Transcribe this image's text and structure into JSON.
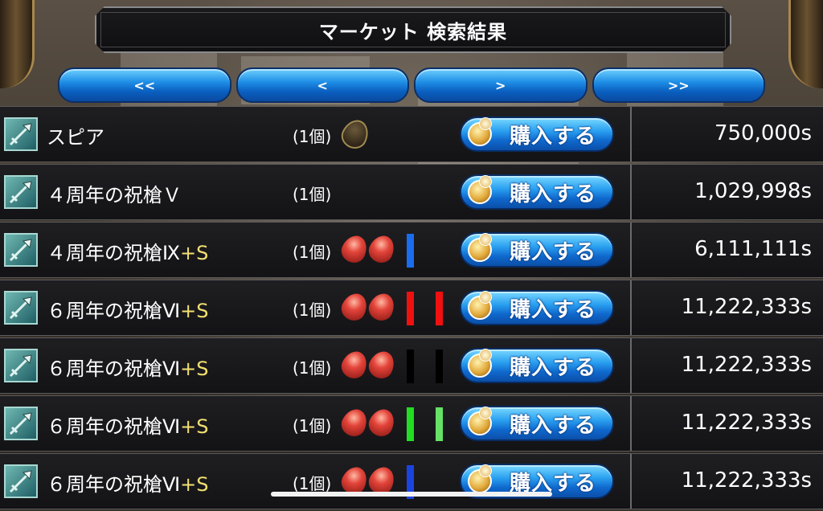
{
  "header": {
    "title": "マーケット 検索結果"
  },
  "nav": {
    "first_label": "<<",
    "prev_label": "<",
    "next_label": ">",
    "last_label": ">>"
  },
  "buy_label": "購入する",
  "rows": [
    {
      "name": "スピア",
      "plus": "",
      "qty": "(1個)",
      "gems": "empty",
      "bars": [],
      "price": "750,000s"
    },
    {
      "name": "４周年の祝槍Ｖ",
      "plus": "",
      "qty": "(1個)",
      "gems": "none",
      "bars": [],
      "price": "1,029,998s"
    },
    {
      "name": "４周年の祝槍Ⅸ",
      "plus": "+S",
      "qty": "(1個)",
      "gems": "red2",
      "bars": [
        "#1a6cf0"
      ],
      "price": "6,111,111s"
    },
    {
      "name": "６周年の祝槍Ⅵ",
      "plus": "+S",
      "qty": "(1個)",
      "gems": "red2",
      "bars": [
        "#f01010",
        "#f01010"
      ],
      "price": "11,222,333s"
    },
    {
      "name": "６周年の祝槍Ⅵ",
      "plus": "+S",
      "qty": "(1個)",
      "gems": "red2",
      "bars": [
        "#000000",
        "#000000"
      ],
      "price": "11,222,333s"
    },
    {
      "name": "６周年の祝槍Ⅵ",
      "plus": "+S",
      "qty": "(1個)",
      "gems": "red2",
      "bars": [
        "#22dd22",
        "#66e066"
      ],
      "price": "11,222,333s"
    },
    {
      "name": "６周年の祝槍Ⅵ",
      "plus": "+S",
      "qty": "(1個)",
      "gems": "red2",
      "bars": [
        "#1a44e0"
      ],
      "price": "11,222,333s"
    }
  ],
  "icons": {
    "item": "spear-icon",
    "coin": "coin-icon",
    "gem": "red-gem-icon",
    "slot": "empty-slot-icon"
  },
  "colors": {
    "button_blue": "#1f8fe6",
    "plus_yellow": "#f3e070"
  }
}
